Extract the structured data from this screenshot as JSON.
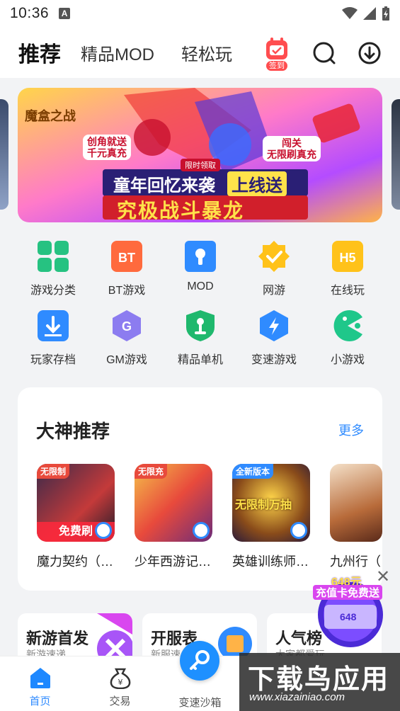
{
  "status_bar": {
    "time": "10:36",
    "a_badge": "A"
  },
  "top_nav": {
    "tabs": [
      {
        "label": "推荐",
        "active": true
      },
      {
        "label": "精品MOD",
        "active": false
      },
      {
        "label": "轻松玩",
        "active": false
      }
    ],
    "signin_label": "签到"
  },
  "banner": {
    "logo_text": "魔盒之战",
    "tag_left": "创角就送\n千元真充",
    "tag_right": "闯关\n无限刷真充",
    "limited": "限时领取",
    "headline": "童年回忆来袭",
    "headline_tag": "上线送",
    "subline": "究极战斗暴龙"
  },
  "grid": [
    {
      "label": "游戏分类",
      "icon": "grid-four-icon",
      "color": "#26c281"
    },
    {
      "label": "BT游戏",
      "icon": "bt-icon",
      "color": "#ff6a3d"
    },
    {
      "label": "MOD",
      "icon": "mod-icon",
      "color": "#2f8bff"
    },
    {
      "label": "网游",
      "icon": "badge-check-icon",
      "color": "#ffc21a"
    },
    {
      "label": "在线玩",
      "icon": "h5-icon",
      "color": "#ffc21a"
    },
    {
      "label": "玩家存档",
      "icon": "download-box-icon",
      "color": "#2f8bff"
    },
    {
      "label": "GM游戏",
      "icon": "gm-icon",
      "color": "#8c7cf0"
    },
    {
      "label": "精品单机",
      "icon": "joystick-shield-icon",
      "color": "#1fb86d"
    },
    {
      "label": "变速游戏",
      "icon": "speed-bolt-icon",
      "color": "#2f8bff"
    },
    {
      "label": "小游戏",
      "icon": "pacman-icon",
      "color": "#1fc78a"
    }
  ],
  "recommend": {
    "title": "大神推荐",
    "more": "更多",
    "games": [
      {
        "name": "魔力契约（…",
        "ribbon": "无限制",
        "bottom": "免费刷"
      },
      {
        "name": "少年西游记…",
        "ribbon": "无限充",
        "bottom": ""
      },
      {
        "name": "英雄训练师…",
        "ribbon": "全新版本",
        "bottom": "无限制万抽"
      },
      {
        "name": "九州行（",
        "ribbon": "",
        "bottom": ""
      }
    ]
  },
  "rank_cards": [
    {
      "title": "新游首发",
      "sub": "新游速递"
    },
    {
      "title": "开服表",
      "sub": "新服速"
    },
    {
      "title": "人气榜",
      "sub": "大家都爱玩"
    }
  ],
  "promo": {
    "amount": "648元",
    "text": "充值卡免费送",
    "value": "648"
  },
  "bottom_bar": {
    "items": [
      {
        "label": "首页",
        "active": true
      },
      {
        "label": "交易",
        "active": false
      },
      {
        "label": "变速沙箱",
        "active": false
      },
      {
        "label": "",
        "active": false
      },
      {
        "label": "",
        "active": false
      }
    ]
  },
  "watermark": {
    "main": "下载鸟应用",
    "sub": "www.xiazainiao.com"
  }
}
